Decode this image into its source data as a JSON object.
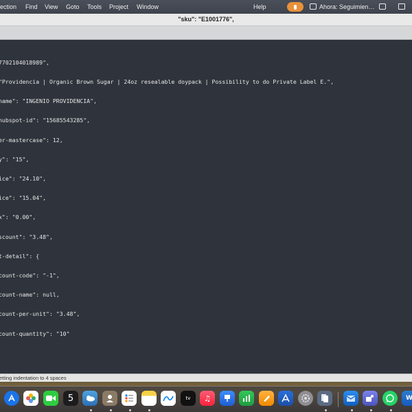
{
  "menubar": {
    "items": [
      "lection",
      "Find",
      "View",
      "Goto",
      "Tools",
      "Project",
      "Window",
      "Help"
    ],
    "mic_icon": "microphone-icon",
    "status_text": "Ahora: Seguimien…"
  },
  "editor": {
    "tab_title": "\"sku\": \"E1001776\",",
    "lines": [
      "7702104018989\",",
      "\"Providencia | Organic Brown Sugar | 24oz resealable doypack | Possibility to do Private Label E.\",",
      "name\": \"INGENIO PROVIDENCIA\",",
      "hubspot-id\": \"15685543285\",",
      "er-mastercase\": 12,",
      "y\": \"15\",",
      "ice\": \"24.10\",",
      "ice\": \"15.04\",",
      "x\": \"0.00\",",
      "scount\": \"3.48\",",
      "t-detail\": {",
      "count-code\": \"-1\",",
      "count-name\": null,",
      "count-per-unit\": \"3.48\",",
      "count-quantity\": \"10\""
    ]
  },
  "statusbar": {
    "message": "etting indentation to 4 spaces"
  },
  "dock": {
    "calendar_day": "5",
    "icons": [
      "app-store-icon",
      "photos-icon",
      "facetime-icon",
      "calendar-icon",
      "weather-icon",
      "contacts-icon",
      "reminders-icon",
      "notes-icon",
      "freeform-icon",
      "apple-tv-icon",
      "music-icon",
      "keynote-icon",
      "numbers-icon",
      "pages-icon",
      "xcode-instruments-icon",
      "system-settings-icon",
      "preview-icon",
      "outlook-icon",
      "teams-icon",
      "whatsapp-icon",
      "word-icon"
    ]
  }
}
